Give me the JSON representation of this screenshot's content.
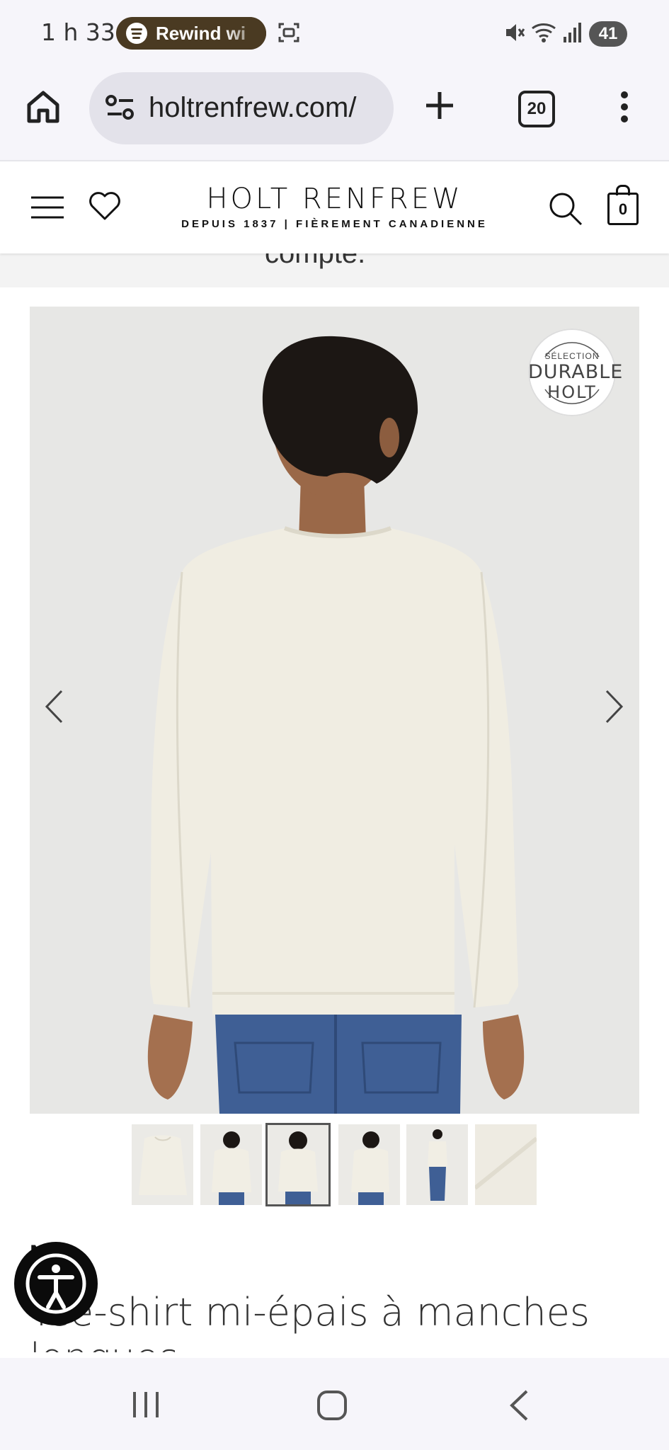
{
  "status_bar": {
    "time": "1 h 33",
    "media_pill": "Rewind wi",
    "battery": "41"
  },
  "browser": {
    "url": "holtrenfrew.com/",
    "tab_count": "20"
  },
  "site_header": {
    "logo": "HOLT RENFREW",
    "tagline": "DEPUIS 1837 | FIÈREMENT CANADIENNE",
    "bag_count": "0"
  },
  "peek_text": "compte.",
  "gallery": {
    "badge": {
      "line1": "SÉLECTION",
      "line2": "DURABLE",
      "line3": "HOLT"
    },
    "thumbnail_count": 6,
    "selected_index": 3
  },
  "product": {
    "brand": "N",
    "title": "Tee-shirt mi-épais à manches longues"
  },
  "colors": {
    "status_bg": "#f6f5fa",
    "omnibox_bg": "#e3e2ea",
    "pill_bg": "#4a3a22",
    "image_bg": "#e6e6e4",
    "shirt": "#f0ede2",
    "denim": "#3f5f95"
  }
}
